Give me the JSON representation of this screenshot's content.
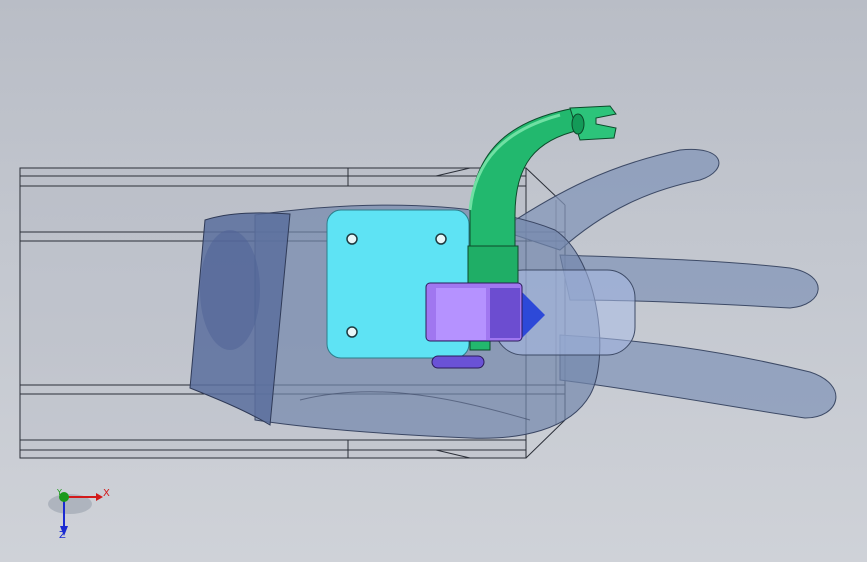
{
  "app": {
    "view_name": "cad-3d-viewport"
  },
  "colors": {
    "background_top": "#b9bdc6",
    "background_bottom": "#cfd2d8",
    "hand": "#7f93b6",
    "glove": "#5a6e9e",
    "mount_plate": "#5ee3f4",
    "bracket": "#22b86e",
    "hinge": "#a077f0",
    "axis_x": "#d21a1a",
    "axis_y": "#1c9a1c",
    "axis_z": "#1a2ad2"
  },
  "triad": {
    "x_label": "X",
    "y_label": "Y",
    "z_label": "Z"
  }
}
